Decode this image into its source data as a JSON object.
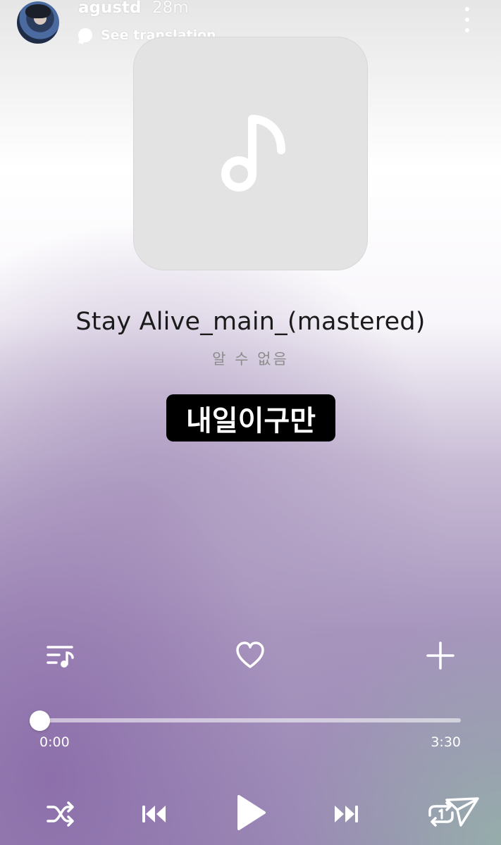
{
  "header": {
    "username": "agustd",
    "time_ago": "28m",
    "translation_label": "See translation",
    "avatar_icon": "profile-photo",
    "more_icon": "more-vertical-icon"
  },
  "track": {
    "title": "Stay Alive_main_(mastered)",
    "artist": "알 수 없음",
    "artwork_icon": "music-note-icon"
  },
  "sticker": {
    "text": "내일이구만"
  },
  "actions": {
    "playlist_icon": "playlist-icon",
    "favorite_icon": "heart-icon",
    "add_icon": "plus-icon"
  },
  "progress": {
    "current": "0:00",
    "duration": "3:30",
    "fraction": 0
  },
  "controls": {
    "shuffle_icon": "shuffle-icon",
    "previous_icon": "previous-icon",
    "play_icon": "play-icon",
    "next_icon": "next-icon",
    "repeat_icon": "repeat-one-icon",
    "send_icon": "send-icon"
  },
  "colors": {
    "artwork_bg": "#e3e3e3",
    "sticker_bg": "#000000",
    "accent": "#ffffff"
  }
}
